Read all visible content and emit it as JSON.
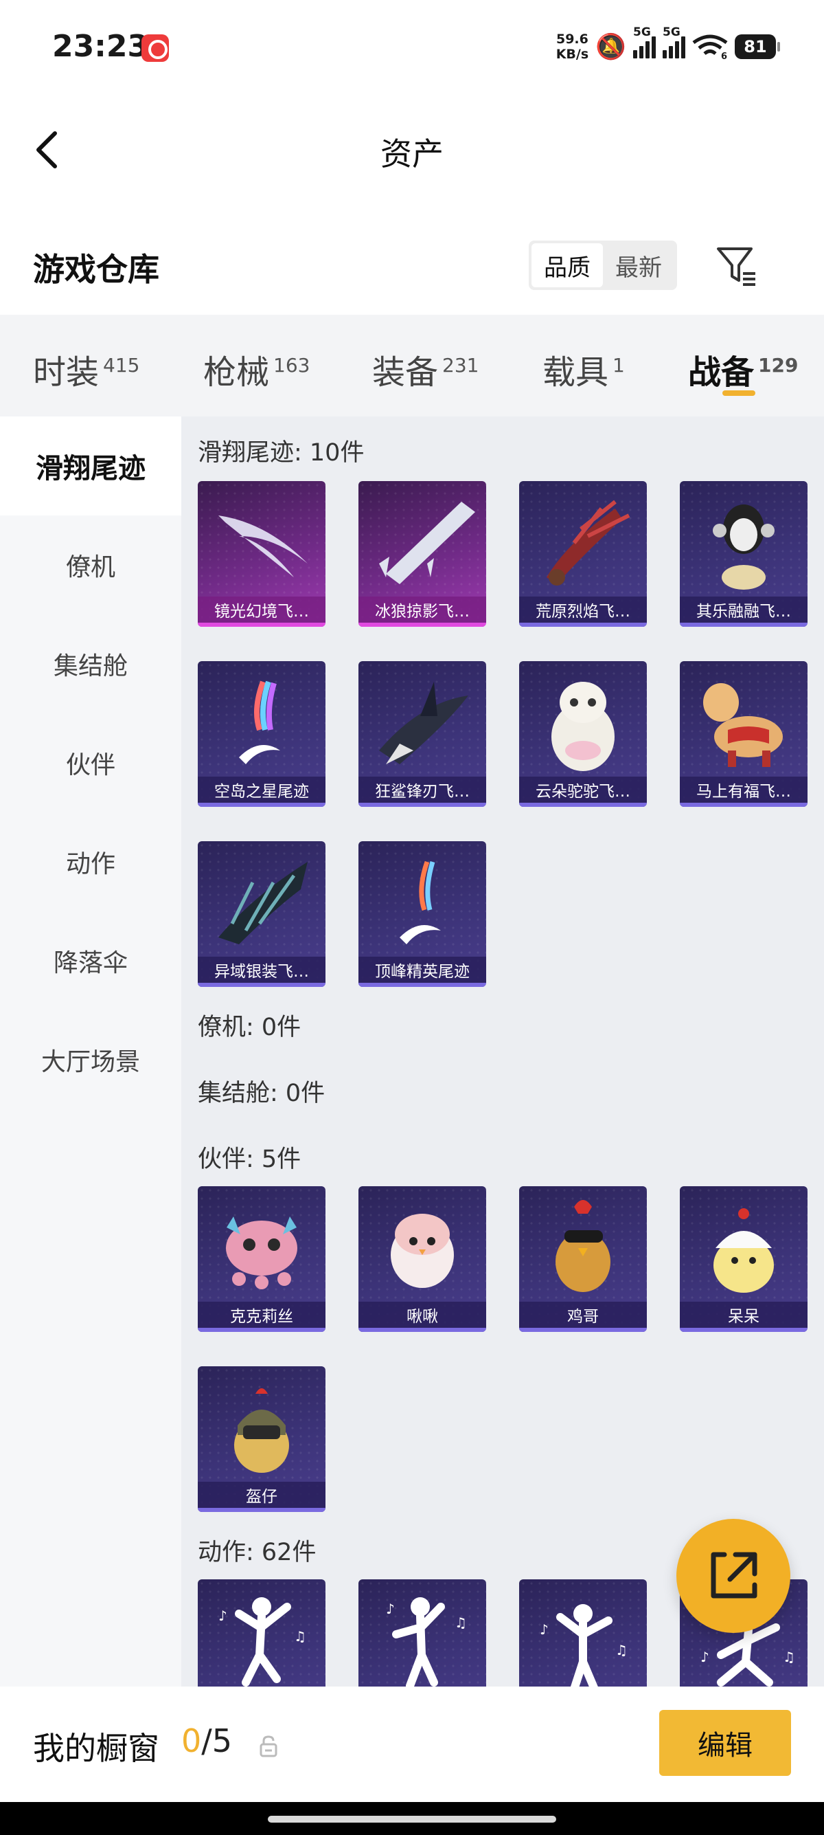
{
  "status_bar": {
    "time": "23:23",
    "net_speed_value": "59.6",
    "net_speed_unit": "KB/s",
    "sim1": "5G",
    "sim2": "5G",
    "wifi_sub": "6",
    "battery": "81"
  },
  "header": {
    "title": "资产"
  },
  "section": {
    "title": "游戏仓库",
    "sort_options": [
      "品质",
      "最新"
    ],
    "sort_selected": "品质"
  },
  "tabs": [
    {
      "label": "时装",
      "count": "415"
    },
    {
      "label": "枪械",
      "count": "163"
    },
    {
      "label": "装备",
      "count": "231"
    },
    {
      "label": "载具",
      "count": "1"
    },
    {
      "label": "战备",
      "count": "129"
    }
  ],
  "active_tab": "战备",
  "sidebar": {
    "items": [
      "滑翔尾迹",
      "僚机",
      "集结舱",
      "伙伴",
      "动作",
      "降落伞",
      "大厅场景"
    ],
    "active": "滑翔尾迹"
  },
  "groups": {
    "trails": {
      "title": "滑翔尾迹: 10件",
      "items": [
        "镜光幻境飞…",
        "冰狼掠影飞…",
        "荒原烈焰飞…",
        "其乐融融飞…",
        "空岛之星尾迹",
        "狂鲨锋刃飞…",
        "云朵驼驼飞…",
        "马上有福飞…",
        "异域银装飞…",
        "顶峰精英尾迹"
      ]
    },
    "wingman": {
      "title": "僚机: 0件"
    },
    "pod": {
      "title": "集结舱: 0件"
    },
    "partners": {
      "title": "伙伴: 5件",
      "items": [
        "克克莉丝",
        "啾啾",
        "鸡哥",
        "呆呆",
        "盔仔"
      ]
    },
    "emotes": {
      "title": "动作: 62件"
    }
  },
  "bottom": {
    "showcase_label": "我的橱窗",
    "showcase_current": "0",
    "showcase_total": "/5",
    "edit_label": "编辑"
  },
  "colors": {
    "accent": "#f1b12f",
    "card_purple": "#3c3378",
    "card_pink": "#a03bb2"
  }
}
